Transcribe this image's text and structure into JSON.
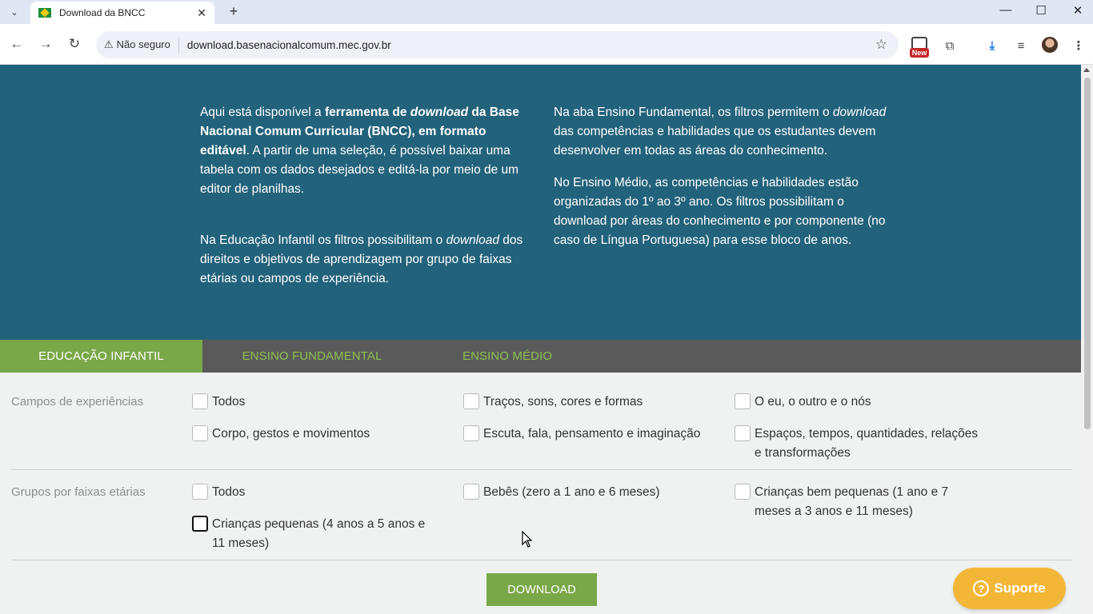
{
  "browser": {
    "tab_title": "Download da BNCC",
    "security_label": "Não seguro",
    "url": "download.basenacionalcomum.mec.gov.br",
    "extension_badge": "New"
  },
  "hero": {
    "col1_p1_a": "Aqui está disponível a ",
    "col1_p1_b": "ferramenta de ",
    "col1_p1_c": "download",
    "col1_p1_d": " da Base Nacional Comum Curricular (BNCC), em formato editável",
    "col1_p1_e": ". A partir de uma seleção, é possível baixar uma tabela com os dados desejados e editá-la por meio de um editor de planilhas.",
    "col1_p2_a": "Na Educação Infantil os filtros possibilitam o ",
    "col1_p2_b": "download",
    "col1_p2_c": " dos direitos e objetivos de aprendizagem por grupo de faixas etárias ou campos de experiência.",
    "col2_p1_a": "Na aba Ensino Fundamental, os filtros permitem o ",
    "col2_p1_b": "download",
    "col2_p1_c": " das competências e habilidades que os estudantes devem desenvolver em todas as áreas do conhecimento.",
    "col2_p2": "No Ensino Médio, as competências e habilidades estão organizadas do 1º ao 3º ano. Os filtros possibilitam o download por áreas do conhecimento e por componente (no caso de Língua Portuguesa) para esse bloco de anos."
  },
  "stage_tabs": [
    "EDUCAÇÃO INFANTIL",
    "ENSINO FUNDAMENTAL",
    "ENSINO MÉDIO"
  ],
  "filters": {
    "campos_label": "Campos de experiências",
    "campos": [
      {
        "label": "Todos",
        "checked": false
      },
      {
        "label": "Traços, sons, cores e formas",
        "checked": false
      },
      {
        "label": "O eu, o outro e o nós",
        "checked": false
      },
      {
        "label": "Corpo, gestos e movimentos",
        "checked": false
      },
      {
        "label": "Escuta, fala, pensamento e imaginação",
        "checked": false
      },
      {
        "label": "Espaços, tempos, quantidades, relações e transformações",
        "checked": false
      }
    ],
    "grupos_label": "Grupos por faixas etárias",
    "grupos": [
      {
        "label": "Todos",
        "checked": false
      },
      {
        "label": "Bebês (zero a 1 ano e 6 meses)",
        "checked": false
      },
      {
        "label": "Crianças bem pequenas (1 ano e 7 meses a 3 anos e 11 meses)",
        "checked": false
      },
      {
        "label": "Crianças pequenas (4 anos a 5 anos e 11 meses)",
        "checked": false
      }
    ]
  },
  "download_label": "DOWNLOAD",
  "support_label": "Suporte",
  "colors": {
    "hero_bg": "#22627b",
    "accent_green": "#7aa748",
    "tabbar_bg": "#5a5a5a",
    "support_yellow": "#f3b738"
  }
}
